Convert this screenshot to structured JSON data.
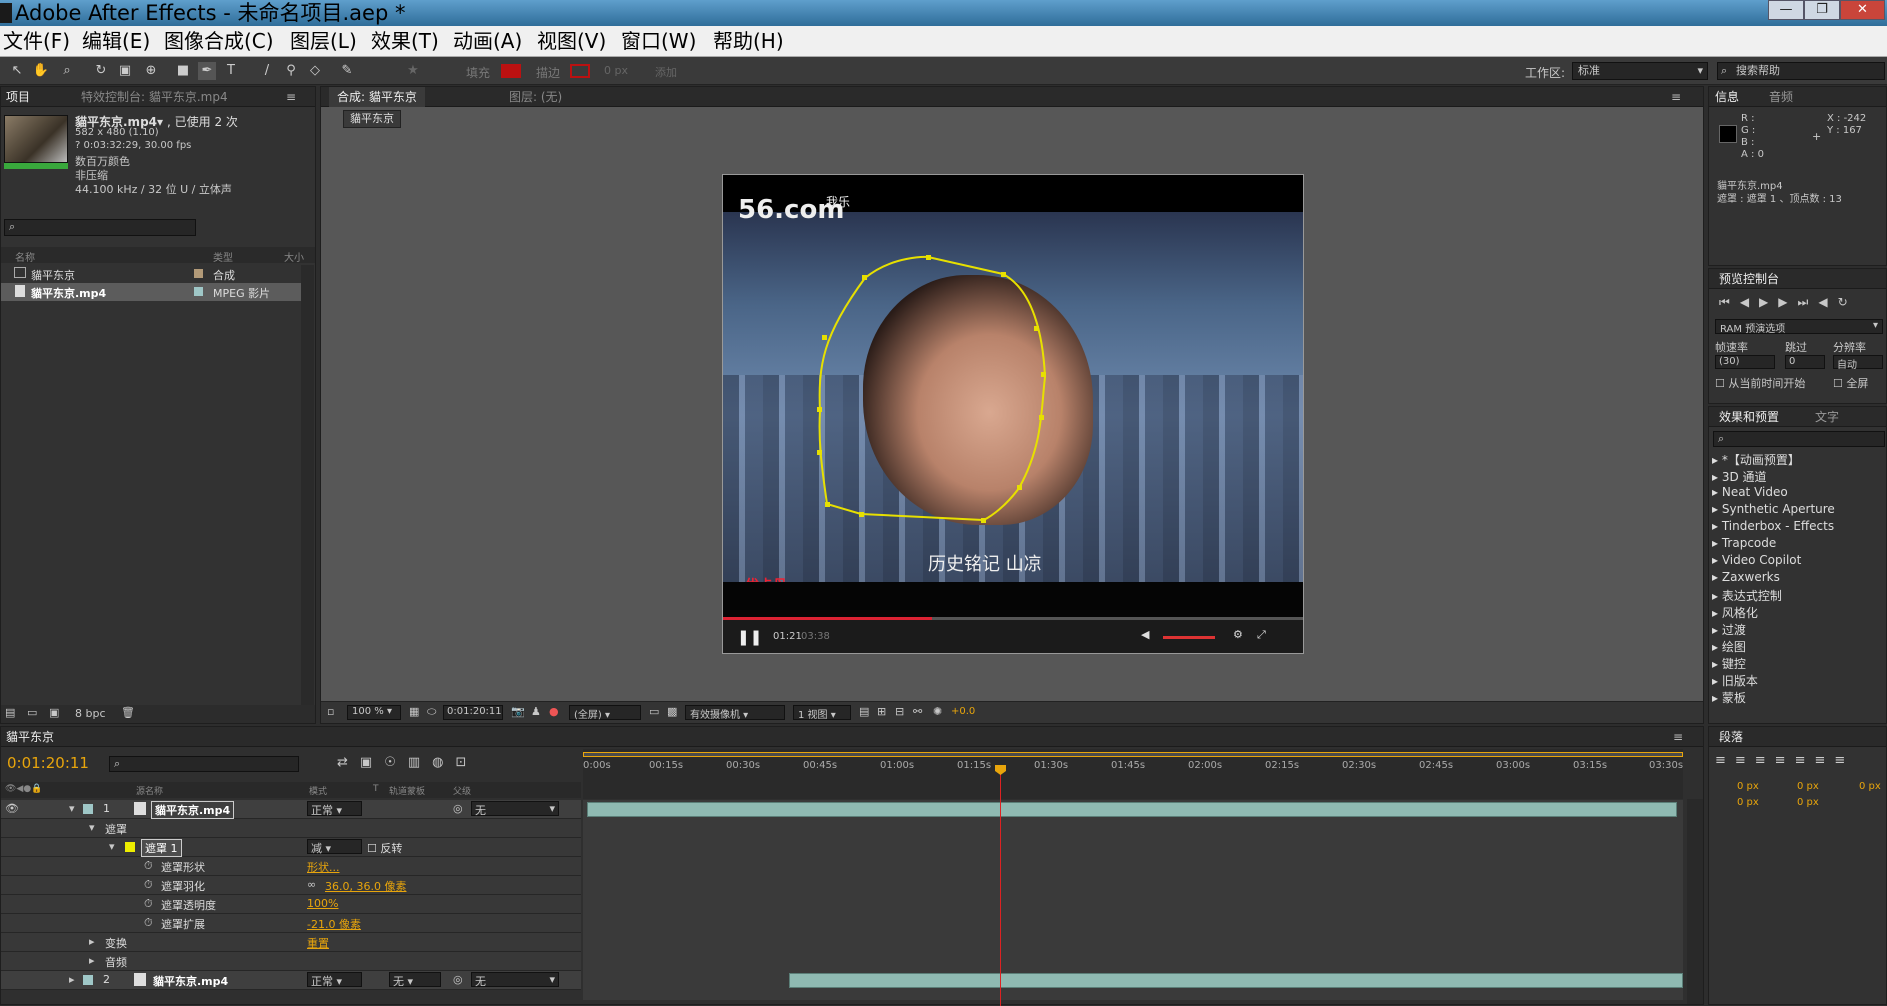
{
  "window": {
    "title": "Adobe After Effects - 未命名项目.aep *",
    "min": "—",
    "max": "❐",
    "close": "✕"
  },
  "menu": [
    "文件(F)",
    "编辑(E)",
    "图像合成(C)",
    "图层(L)",
    "效果(T)",
    "动画(A)",
    "视图(V)",
    "窗口(W)",
    "帮助(H)"
  ],
  "toolbar": {
    "fill": "填充",
    "stroke": "描边",
    "px": "0 px",
    "add": "添加",
    "workspace_label": "工作区:",
    "workspace": "标准",
    "search_placeholder": "搜索帮助"
  },
  "project": {
    "tab": "项目",
    "effects_tab": "特效控制台: 貓平东京.mp4",
    "file_name": "貓平东京.mp4▾",
    "used": ", 已使用 2 次",
    "dims": "582 x 480 (1.10)",
    "dur": "? 0:03:32:29, 30.00 fps",
    "colors": "数百万颜色",
    "comp": "非压缩",
    "audio": "44.100 kHz / 32 位 U / 立体声",
    "col_name": "名称",
    "col_type": "类型",
    "col_size": "大小",
    "items": [
      {
        "name": "貓平东京",
        "type": "合成"
      },
      {
        "name": "貓平东京.mp4",
        "type": "MPEG 影片"
      }
    ],
    "bpc": "8 bpc"
  },
  "comp": {
    "tab": "合成: 貓平东京",
    "layer_tab": "图层: (无)",
    "breadcrumb": "貓平东京",
    "zoom": "100 %",
    "timecode": "0:01:20:11",
    "res": "(全屏)",
    "camera": "有效摄像机",
    "views": "1 视图",
    "exposure": "+0.0"
  },
  "video": {
    "logo": "56.com",
    "logo_sub": "我乐",
    "subtitle": "历史铭记 山凉",
    "stamp": "优卡丹",
    "time": "01:21",
    "total": "03:38"
  },
  "info": {
    "tab": "信息",
    "audio_tab": "音频",
    "r": "R :",
    "g": "G :",
    "b": "B :",
    "a": "A : 0",
    "x": "X : -242",
    "y": "Y : 167",
    "file": "貓平东京.mp4",
    "mask": "遮罩 : 遮罩 1 、顶点数 : 13"
  },
  "preview": {
    "tab": "预览控制台",
    "ram": "RAM 预演选项",
    "fps_label": "帧速率",
    "skip_label": "跳过",
    "res_label": "分辨率",
    "fps": "(30)",
    "skip": "0",
    "res": "自动",
    "from_current": "从当前时间开始",
    "fullscreen": "全屏"
  },
  "effects": {
    "tab": "效果和预置",
    "text_tab": "文字",
    "items": [
      "*【动画预置】",
      "3D 通道",
      "Neat Video",
      "Synthetic Aperture",
      "Tinderbox - Effects",
      "Trapcode",
      "Video Copilot",
      "Zaxwerks",
      "表达式控制",
      "风格化",
      "过渡",
      "绘图",
      "键控",
      "旧版本",
      "蒙板"
    ]
  },
  "paragraph": {
    "tab": "段落",
    "v1": "0 px",
    "v2": "0 px",
    "v3": "0 px",
    "v4": "0 px",
    "v5": "0 px"
  },
  "timeline": {
    "tab": "貓平东京",
    "timecode": "0:01:20:11",
    "col_source": "源名称",
    "col_mode": "模式",
    "col_t": "T",
    "col_trkmat": "轨道蒙板",
    "col_parent": "父级",
    "ticks": [
      "0:00s",
      "00:15s",
      "00:30s",
      "00:45s",
      "01:00s",
      "01:15s",
      "01:30s",
      "01:45s",
      "02:00s",
      "02:15s",
      "02:30s",
      "02:45s",
      "03:00s",
      "03:15s",
      "03:30s"
    ],
    "layer1": {
      "num": "1",
      "name": "貓平东京.mp4",
      "mode": "正常",
      "parent": "无"
    },
    "masks": "遮罩",
    "mask1": "遮罩 1",
    "mask_mode": "减",
    "invert": "反转",
    "mask_shape": "遮罩形状",
    "mask_shape_val": "形状...",
    "mask_feather": "遮罩羽化",
    "mask_feather_val": "36.0, 36.0 像素",
    "mask_opacity": "遮罩透明度",
    "mask_opacity_val": "100%",
    "mask_expand": "遮罩扩展",
    "mask_expand_val": "-21.0 像素",
    "transform": "变换",
    "transform_val": "重置",
    "audio": "音频",
    "layer2": {
      "num": "2",
      "name": "貓平东京.mp4",
      "mode": "正常",
      "trkmat": "无",
      "parent": "无"
    }
  }
}
